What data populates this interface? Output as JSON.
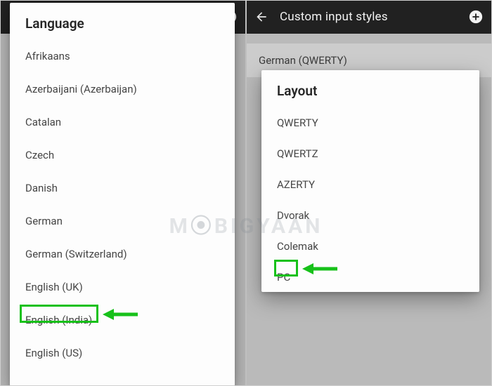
{
  "left": {
    "appbar": {
      "title": ""
    },
    "dialog_title": "Language",
    "items": [
      "Afrikaans",
      "Azerbaijani (Azerbaijan)",
      "Catalan",
      "Czech",
      "Danish",
      "German",
      "German (Switzerland)",
      "English (UK)",
      "English (India)",
      "English (US)"
    ],
    "highlight_item_index": 8
  },
  "right": {
    "appbar": {
      "title": "Custom input styles"
    },
    "existing_row": "German (QWERTY)",
    "dialog_title": "Layout",
    "items": [
      "QWERTY",
      "QWERTZ",
      "AZERTY",
      "Dvorak",
      "Colemak",
      "PC"
    ],
    "highlight_item_index": 5
  },
  "highlight_color": "#17c11a",
  "watermark": "MOBIGYAAN"
}
